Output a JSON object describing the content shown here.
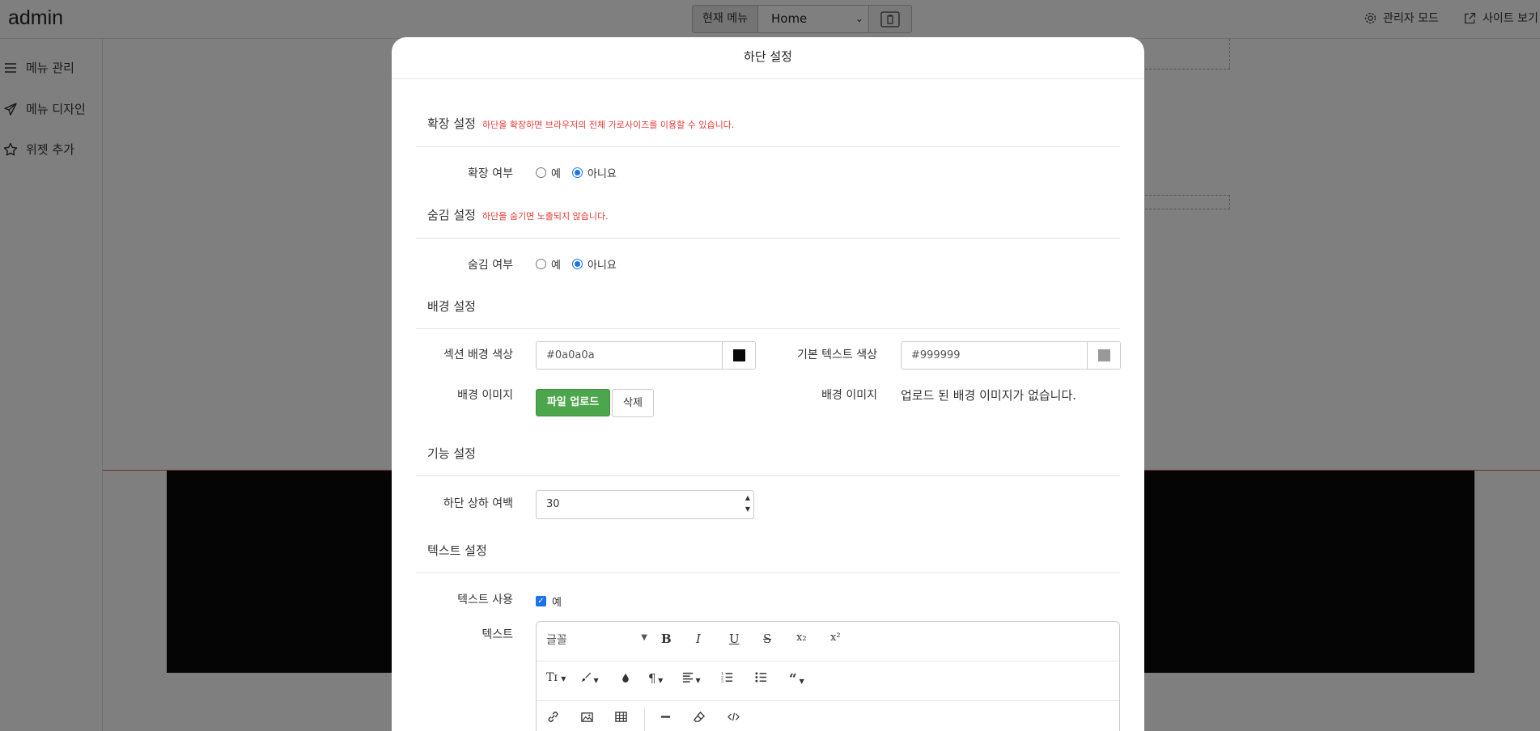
{
  "app": {
    "brand": "admin"
  },
  "topbar": {
    "current_menu_label": "현재 메뉴",
    "current_menu_value": "Home",
    "admin_mode": "관리자 모드",
    "view_site": "사이트 보기"
  },
  "sidebar": {
    "items": [
      {
        "label": "메뉴 관리",
        "icon": "hamburger-icon"
      },
      {
        "label": "메뉴 디자인",
        "icon": "paper-plane-icon"
      },
      {
        "label": "위젯 추가",
        "icon": "star-icon"
      }
    ]
  },
  "modal": {
    "title": "하단 설정",
    "expand": {
      "title": "확장 설정",
      "note": "하단을 확장하면 브라우저의 전체 가로사이즈를 이용할 수 있습니다.",
      "field_label": "확장 여부",
      "option_yes": "예",
      "option_no": "아니요",
      "selected": "아니요"
    },
    "hide": {
      "title": "숨김 설정",
      "note": "하단을 숨기면 노출되지 않습니다.",
      "field_label": "숨김 여부",
      "option_yes": "예",
      "option_no": "아니요",
      "selected": "아니요"
    },
    "background": {
      "title": "배경 설정",
      "section_bg_label": "섹션 배경 색상",
      "section_bg_value": "#0a0a0a",
      "text_color_label": "기본 텍스트 색상",
      "text_color_value": "#999999",
      "bg_image_label": "배경 이미지",
      "upload_button": "파일 업로드",
      "delete_button": "삭제",
      "bg_image_label_right": "배경 이미지",
      "no_image_text": "업로드 된 배경 이미지가 없습니다."
    },
    "function": {
      "title": "기능 설정",
      "padding_label": "하단 상하 여백",
      "padding_value": "30"
    },
    "text": {
      "title": "텍스트 설정",
      "use_label": "텍스트 사용",
      "use_option": "예",
      "use_checked": true,
      "text_label": "텍스트",
      "font_placeholder": "글꼴"
    }
  },
  "colors": {
    "section_bg_swatch": "#0a0a0a",
    "text_color_swatch": "#999999",
    "accent": "#1a73e8",
    "upload_green": "#4ca64c",
    "note_red": "#e53935"
  }
}
